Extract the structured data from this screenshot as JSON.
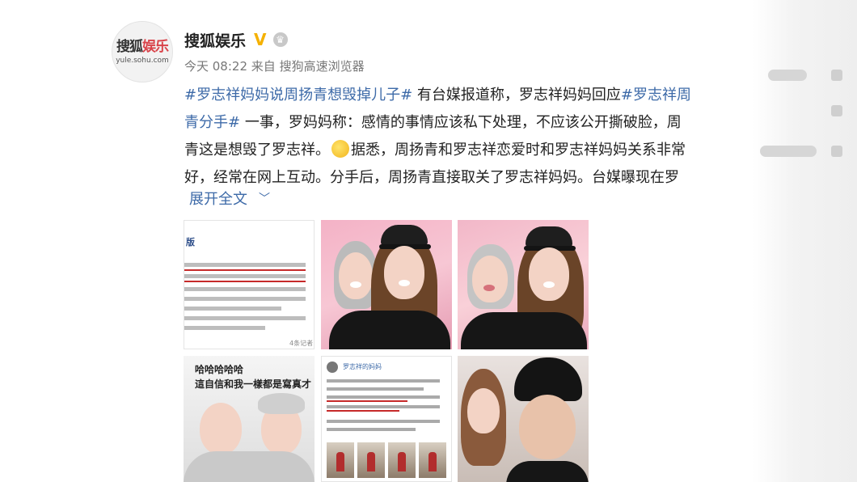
{
  "account": {
    "avatar_logo_cn_left": "搜狐",
    "avatar_logo_cn_right": "娱乐",
    "avatar_logo_url": "yule.sohu.com",
    "name": "搜狐娱乐",
    "verified_badge": "V",
    "level_icon": "crown-icon"
  },
  "meta": {
    "time": "今天 08:22",
    "source_prefix": "来自",
    "source": "搜狗高速浏览器"
  },
  "post": {
    "tag1": "#罗志祥妈妈说周扬青想毁掉儿子#",
    "text1": " 有台媒报道称，罗志祥妈妈回应",
    "tag2a": "#罗志祥周",
    "tag2b": "青分手#",
    "text2": " 一事，罗妈妈称：感情的事情应该私下处理，不应该公开撕破脸，周",
    "text3a": "青这是想毁了罗志祥。",
    "text3b": "据悉，周扬青和罗志祥恋爱时和罗志祥妈妈关系非常",
    "text4": "好，经常在网上互动。分手后，周扬青直接取关了罗志祥妈妈。台媒曝现在罗",
    "expand": "展开全文"
  },
  "photos": {
    "photo1": {
      "title": "版",
      "footer": "4条记者"
    },
    "photo2": {
      "cap_text": ""
    },
    "photo4": {
      "line1": "哈哈哈哈哈",
      "line2": "這自信和我一樣都是寫真才"
    },
    "photo5": {
      "username": "罗志祥的妈妈"
    }
  },
  "colors": {
    "link": "#3d6aa8",
    "verified": "#f5b100",
    "text": "#222222",
    "meta": "#777777"
  }
}
